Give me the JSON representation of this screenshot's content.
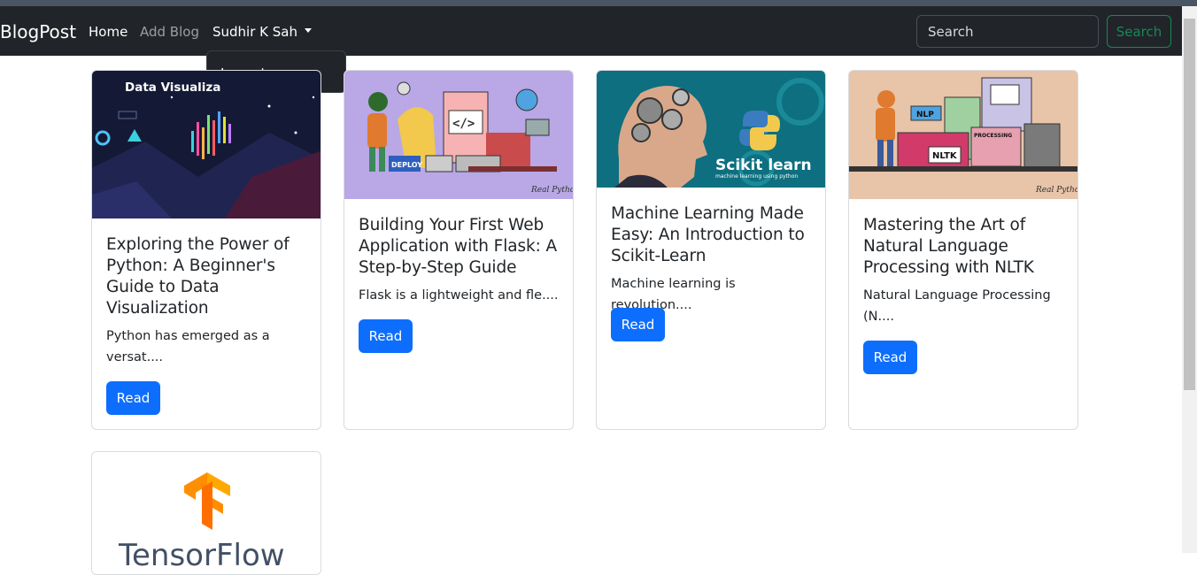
{
  "navbar": {
    "brand": "BlogPost",
    "links": [
      {
        "label": "Home"
      },
      {
        "label": "Add Blog"
      }
    ],
    "user_menu": {
      "label": "Sudhir K Sah",
      "items": [
        {
          "label": "Logout"
        }
      ]
    },
    "search": {
      "placeholder": "Search",
      "button_label": "Search"
    }
  },
  "cards": [
    {
      "image_caption": "Data Visualiza",
      "title": "Exploring the Power of Python: A Beginner's Guide to Data Visualization",
      "excerpt": "Python has emerged as a versat....",
      "button_label": "Read"
    },
    {
      "image_caption": "Real Python",
      "image_badge": "DEPLOY",
      "title": "Building Your First Web Application with Flask: A Step-by-Step Guide",
      "excerpt": "Flask is a lightweight and fle....",
      "button_label": "Read"
    },
    {
      "image_caption": "Scikit learn",
      "image_subcaption": "machine learning using python",
      "title": "Machine Learning Made Easy: An Introduction to Scikit-Learn",
      "excerpt": "Machine learning is revolution....",
      "button_label": "Read"
    },
    {
      "image_caption": "Real Python",
      "image_badges": [
        "NLP",
        "NLTK",
        "PROCESSING"
      ],
      "title": "Mastering the Art of Natural Language Processing with NLTK",
      "excerpt": "Natural Language Processing (N....",
      "button_label": "Read"
    },
    {
      "image_caption": "TensorFlow",
      "title": "",
      "excerpt": "",
      "button_label": ""
    }
  ],
  "colors": {
    "navbar_bg": "#212529",
    "primary": "#0d6efd",
    "success": "#198754"
  }
}
